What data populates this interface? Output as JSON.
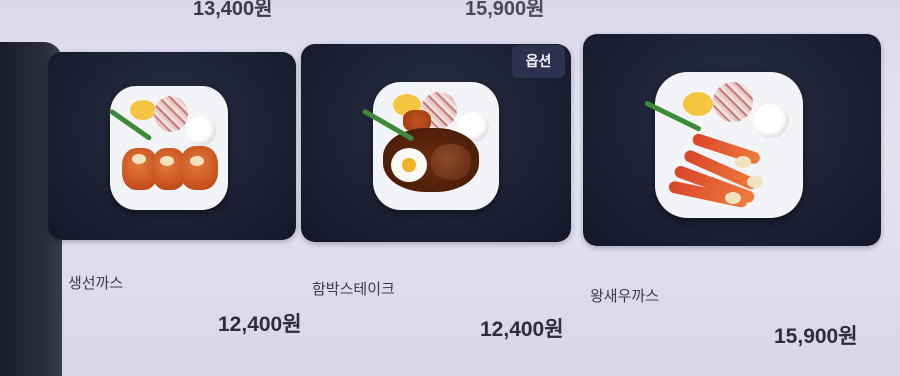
{
  "top_prices": [
    "13,400원",
    "15,900원"
  ],
  "menu_items": [
    {
      "name": "생선까스",
      "price": "12,400원"
    },
    {
      "name": "함박스테이크",
      "price": "12,400원",
      "badge": "옵션"
    },
    {
      "name": "왕새우까스",
      "price": "15,900원"
    }
  ]
}
